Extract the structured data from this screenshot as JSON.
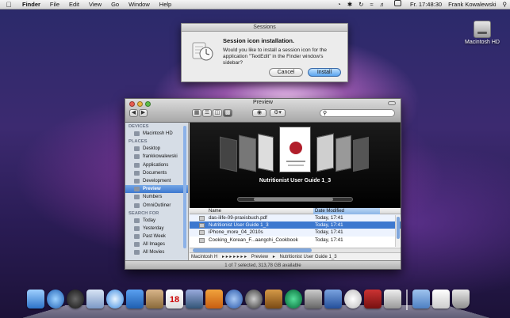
{
  "menubar": {
    "app": "Finder",
    "menus": [
      "File",
      "Edit",
      "View",
      "Go",
      "Window",
      "Help"
    ],
    "clock": "Fr. 17:48:30",
    "user": "Frank Kowalewski"
  },
  "desktop": {
    "volume_label": "Macintosh HD"
  },
  "dialog": {
    "window_title": "Sessions",
    "title": "Session icon installation.",
    "message": "Would you like to install a session icon for the application \"TextEdit\" in the Finder window's sidebar?",
    "cancel_label": "Cancel",
    "install_label": "Install"
  },
  "finder": {
    "title": "Preview",
    "devices_header": "DEVICES",
    "devices": [
      "Macintosh HD"
    ],
    "places_header": "PLACES",
    "places": [
      "Desktop",
      "frankkowalewski",
      "Applications",
      "Documents",
      "Development",
      "Preview",
      "Numbers",
      "OmniOutliner"
    ],
    "search_header": "SEARCH FOR",
    "searches": [
      "Today",
      "Yesterday",
      "Past Week",
      "All Images",
      "All Movies"
    ],
    "selected_place": "Preview",
    "coverflow_title": "Nutritionist User Guide 1_3",
    "columns": {
      "name": "Name",
      "date": "Date Modified"
    },
    "rows": [
      {
        "name": "das-ilife-09-praxisbuch.pdf",
        "date": "Today, 17:41"
      },
      {
        "name": "Nutritionist User Guide 1_3",
        "date": "Today, 17:41"
      },
      {
        "name": "iPhone_more_04_2010s",
        "date": "Today, 17:41"
      },
      {
        "name": "Cooking_Korean_F...aangchi_Cookbook",
        "date": "Today, 17:41"
      }
    ],
    "selected_row": 1,
    "path": [
      "Macintosh H",
      "Preview",
      "Nutritionist User Guide 1_3"
    ],
    "status": "1 of 7 selected, 313,78 GB available"
  },
  "dock": {
    "apps": [
      "finder",
      "app-store",
      "dashboard",
      "mail",
      "safari",
      "facetime",
      "address-book",
      "ical",
      "iphoto",
      "itunes",
      "quicktime",
      "garageband",
      "time-machine",
      "preview",
      "xcode",
      "clock",
      "dictionary",
      "utilities",
      "applications",
      "documents",
      "trash"
    ]
  },
  "colors": {
    "selection": "#3d78cf",
    "sidebar": "#d6dde6",
    "install_button": "#5aa4ee"
  }
}
